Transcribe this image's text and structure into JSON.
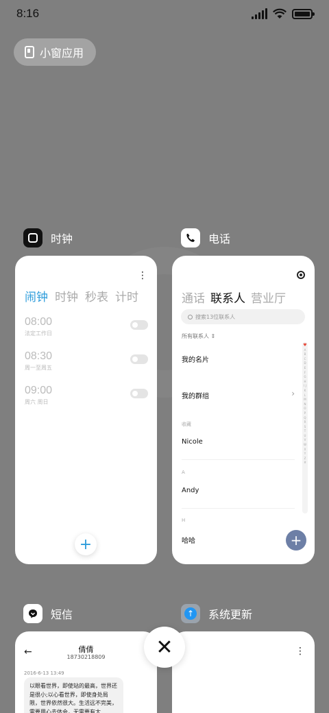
{
  "status_bar": {
    "time": "8:16"
  },
  "mini_window": {
    "label": "小窗应用"
  },
  "apps": {
    "clock": {
      "name": "时钟",
      "tabs": [
        "闹钟",
        "时钟",
        "秒表",
        "计时"
      ],
      "alarms": [
        {
          "time": "08:00",
          "sub": "法定工作日"
        },
        {
          "time": "08:30",
          "sub": "周一至周五"
        },
        {
          "time": "09:00",
          "sub": "周六 周日"
        }
      ],
      "add": "+"
    },
    "phone": {
      "name": "电话",
      "tabs": [
        "通话",
        "联系人",
        "营业厅"
      ],
      "search_placeholder": "搜索13位联系人",
      "all_contacts": "所有联系人 ⇕",
      "my_card": "我的名片",
      "my_group": "我的群组",
      "sections": [
        "收藏",
        "A",
        "H"
      ],
      "contacts": [
        "Nicole",
        "Andy",
        "哈哈"
      ],
      "alphabet": "A B C D E F G H I J K L M N O P Q R S T U V W X Y Z #",
      "add": "+"
    },
    "sms": {
      "name": "短信",
      "contact_name": "倩倩",
      "number": "18730218809",
      "date": "2016-6-13 13:49",
      "message": "以眼看世界，即使站的最高，世界还是很小;以心看世界，即使身处局限，世界依然很大。生活远不完美，需要用心去体会，无需要有太"
    },
    "update": {
      "name": "系统更新"
    }
  },
  "close": "✕"
}
